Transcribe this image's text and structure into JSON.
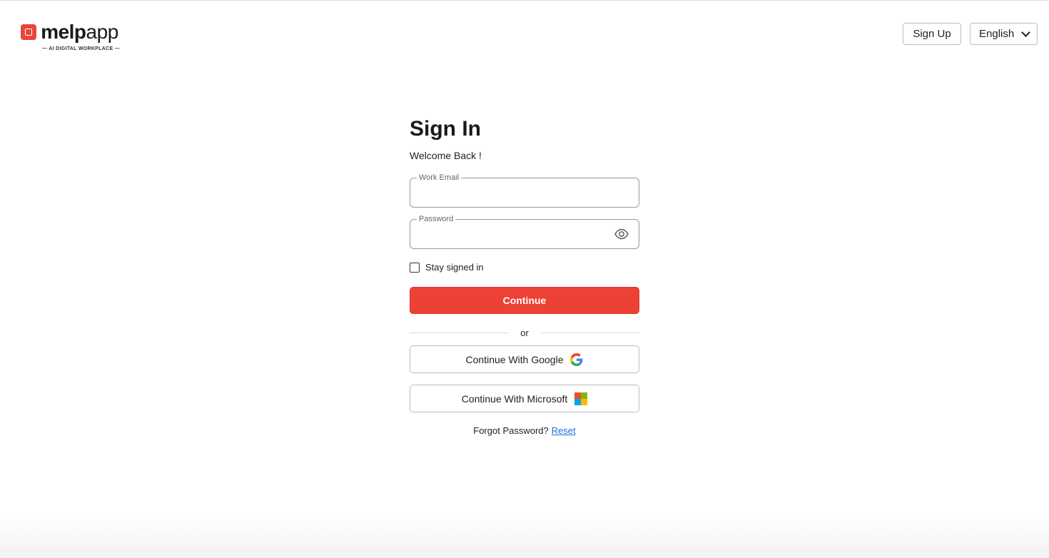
{
  "header": {
    "logo_brand": "melp",
    "logo_app": "app",
    "logo_tagline": "— AI DIGITAL WORKPLACE —",
    "signup_label": "Sign Up",
    "language": "English"
  },
  "form": {
    "title": "Sign In",
    "subtitle": "Welcome Back !",
    "email_label": "Work Email",
    "email_value": "",
    "password_label": "Password",
    "password_value": "",
    "stay_signed_in_label": "Stay signed in",
    "stay_signed_in_checked": false,
    "continue_label": "Continue",
    "divider_text": "or",
    "google_label": "Continue With Google",
    "microsoft_label": "Continue With Microsoft",
    "forgot_text": "Forgot Password?",
    "reset_label": "Reset"
  },
  "colors": {
    "brand_red": "#ee4136",
    "link_blue": "#1a6fd6"
  },
  "icons": [
    "melp-logo-icon",
    "chevron-down-icon",
    "eye-icon",
    "google-icon",
    "microsoft-icon"
  ]
}
